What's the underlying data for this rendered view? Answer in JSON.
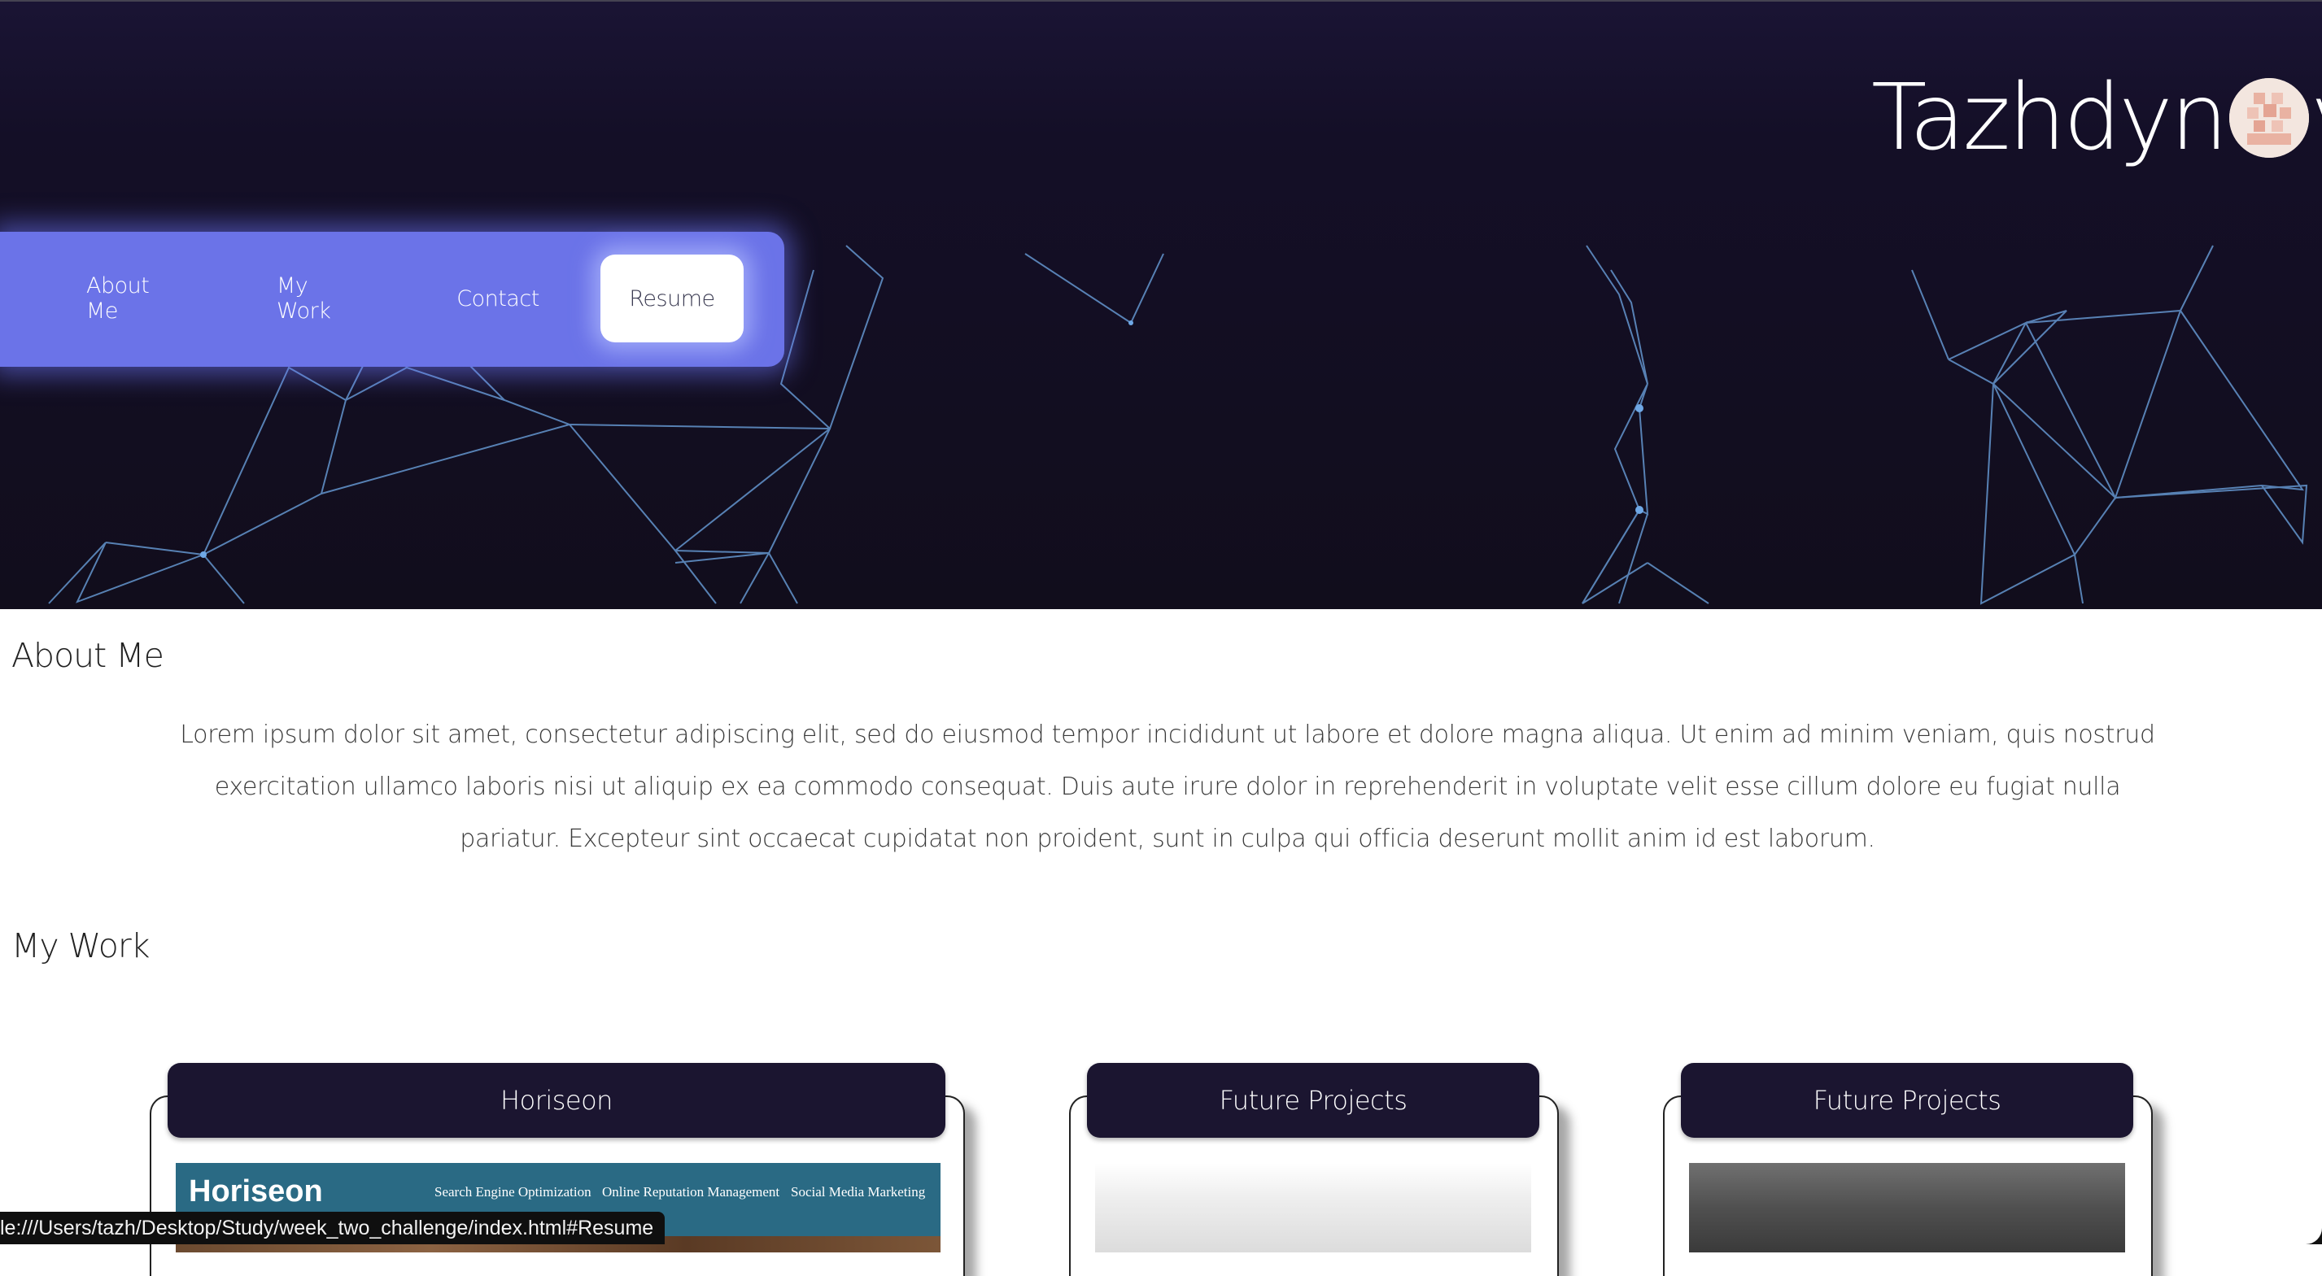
{
  "brand": {
    "name_before": "Tazhdyn",
    "name_after": "v"
  },
  "nav": {
    "items": [
      {
        "label": "About Me"
      },
      {
        "label": "My Work"
      },
      {
        "label": "Contact"
      },
      {
        "label": "Resume",
        "active": true
      }
    ]
  },
  "about": {
    "title": "About Me",
    "text": "Lorem ipsum dolor sit amet, consectetur adipiscing elit, sed do eiusmod tempor incididunt ut labore et dolore magna aliqua. Ut enim ad minim veniam, quis nostrud exercitation ullamco laboris nisi ut aliquip ex ea commodo consequat. Duis aute irure dolor in reprehenderit in voluptate velit esse cillum dolore eu fugiat nulla pariatur. Excepteur sint occaecat cupidatat non proident, sunt in culpa qui officia deserunt mollit anim id est laborum."
  },
  "work": {
    "title": "My Work",
    "cards": [
      {
        "title": "Horiseon",
        "preview": {
          "logo": "Horiseon",
          "nav": [
            "Search Engine Optimization",
            "Online Reputation Management",
            "Social Media Marketing"
          ]
        }
      },
      {
        "title": "Future Projects"
      },
      {
        "title": "Future Projects"
      }
    ]
  },
  "status_bar": {
    "url": "le:///Users/tazh/Desktop/Study/week_two_challenge/index.html#Resume"
  },
  "colors": {
    "hero_bg": "#110d1c",
    "nav_bg": "#6b73e8",
    "card_header_bg": "#1b1530",
    "network_lines": "#6fa8e6"
  }
}
